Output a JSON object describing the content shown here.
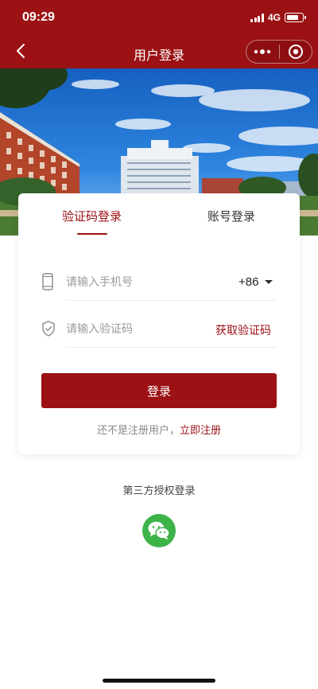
{
  "status_bar": {
    "time": "09:29",
    "network": "4G"
  },
  "nav": {
    "title": "用户登录"
  },
  "tabs": [
    {
      "label": "验证码登录",
      "active": true
    },
    {
      "label": "账号登录",
      "active": false
    }
  ],
  "form": {
    "phone_placeholder": "请输入手机号",
    "country_code": "+86",
    "code_placeholder": "请输入验证码",
    "get_code_label": "获取验证码",
    "login_label": "登录",
    "register_prompt": "还不是注册用户，",
    "register_link": "立即注册"
  },
  "third_party": {
    "label": "第三方授权登录"
  },
  "icons": {
    "back": "chevron-left-icon",
    "more": "more-dots-icon",
    "close_miniprogram": "target-circle-icon",
    "phone": "phone-icon",
    "shield": "shield-check-icon",
    "wechat": "wechat-icon"
  },
  "colors": {
    "brand": "#9b1114",
    "wechat": "#3db34a"
  }
}
